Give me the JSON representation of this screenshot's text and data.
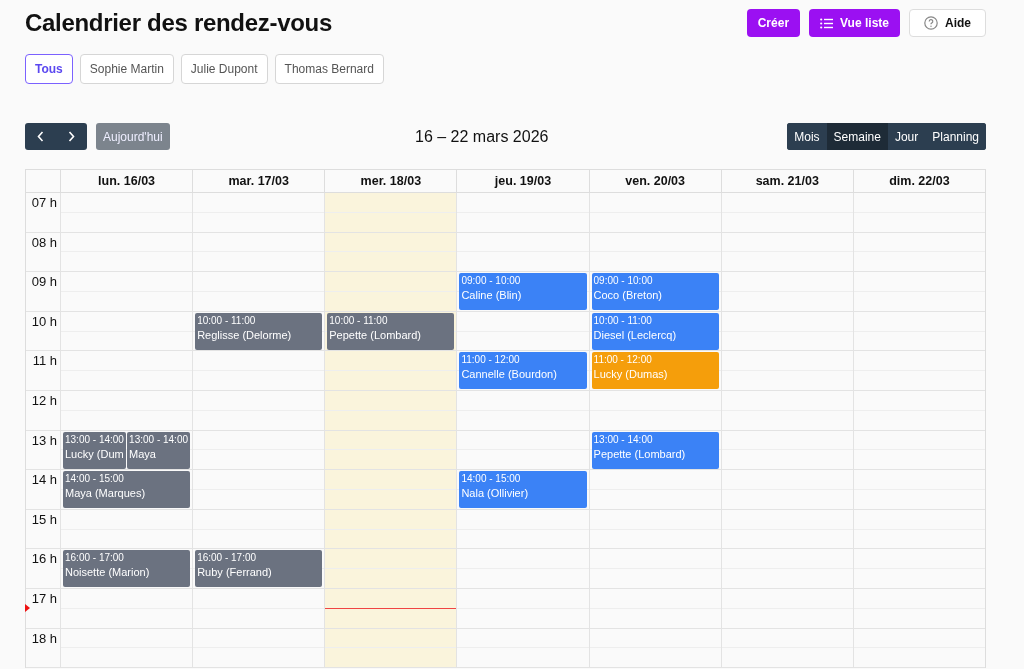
{
  "title": "Calendrier des rendez-vous",
  "actions": [
    {
      "label": "Créer",
      "kind": "primary"
    },
    {
      "label": "Vue liste",
      "kind": "list"
    },
    {
      "label": "Aide",
      "kind": "help"
    }
  ],
  "filters": [
    {
      "label": "Tous",
      "selected": true
    },
    {
      "label": "Sophie Martin",
      "selected": false
    },
    {
      "label": "Julie Dupont",
      "selected": false
    },
    {
      "label": "Thomas Bernard",
      "selected": false
    }
  ],
  "today_button": "Aujourd'hui",
  "range": "16 – 22 mars 2026",
  "views": [
    {
      "label": "Mois",
      "selected": false
    },
    {
      "label": "Semaine",
      "selected": true
    },
    {
      "label": "Jour",
      "selected": false
    },
    {
      "label": "Planning",
      "selected": false
    }
  ],
  "days": [
    {
      "label": "lun. 16/03",
      "today": false
    },
    {
      "label": "mar. 17/03",
      "today": false
    },
    {
      "label": "mer. 18/03",
      "today": true
    },
    {
      "label": "jeu. 19/03",
      "today": false
    },
    {
      "label": "ven. 20/03",
      "today": false
    },
    {
      "label": "sam. 21/03",
      "today": false
    },
    {
      "label": "dim. 22/03",
      "today": false
    }
  ],
  "hours": [
    {
      "label": "07 h",
      "cells": [
        [],
        [],
        [],
        [],
        [],
        [],
        []
      ]
    },
    {
      "label": "08 h",
      "cells": [
        [],
        [],
        [],
        [],
        [],
        [],
        []
      ]
    },
    {
      "label": "09 h",
      "cells": [
        [],
        [],
        [],
        [
          {
            "time": "09:00 - 10:00",
            "title": "Caline (Blin)",
            "color": "#3b82f6"
          }
        ],
        [
          {
            "time": "09:00 - 10:00",
            "title": "Coco (Breton)",
            "color": "#3b82f6"
          }
        ],
        [],
        []
      ]
    },
    {
      "label": "10 h",
      "cells": [
        [],
        [
          {
            "time": "10:00 - 11:00",
            "title": "Reglisse (Delorme)",
            "color": "#6b7280"
          }
        ],
        [
          {
            "time": "10:00 - 11:00",
            "title": "Pepette (Lombard)",
            "color": "#6b7280"
          }
        ],
        [],
        [
          {
            "time": "10:00 - 11:00",
            "title": "Diesel (Leclercq)",
            "color": "#3b82f6"
          }
        ],
        [],
        []
      ]
    },
    {
      "label": "11 h",
      "cells": [
        [],
        [],
        [],
        [
          {
            "time": "11:00 - 12:00",
            "title": "Cannelle (Bourdon)",
            "color": "#3b82f6"
          }
        ],
        [
          {
            "time": "11:00 - 12:00",
            "title": "Lucky (Dumas)",
            "color": "#f59e0b"
          }
        ],
        [],
        []
      ]
    },
    {
      "label": "12 h",
      "cells": [
        [],
        [],
        [],
        [],
        [],
        [],
        []
      ]
    },
    {
      "label": "13 h",
      "cells": [
        [
          {
            "time": "13:00 - 14:00",
            "title": "Lucky (Dum",
            "color": "#6b7280"
          },
          {
            "time": "13:00 - 14:00",
            "title": "Maya",
            "color": "#6b7280"
          }
        ],
        [],
        [],
        [],
        [
          {
            "time": "13:00 - 14:00",
            "title": "Pepette (Lombard)",
            "color": "#3b82f6"
          }
        ],
        [],
        []
      ]
    },
    {
      "label": "14 h",
      "cells": [
        [
          {
            "time": "14:00 - 15:00",
            "title": "Maya (Marques)",
            "color": "#6b7280"
          }
        ],
        [],
        [],
        [
          {
            "time": "14:00 - 15:00",
            "title": "Nala (Ollivier)",
            "color": "#3b82f6"
          }
        ],
        [],
        [],
        []
      ]
    },
    {
      "label": "15 h",
      "cells": [
        [],
        [],
        [],
        [],
        [],
        [],
        []
      ]
    },
    {
      "label": "16 h",
      "cells": [
        [
          {
            "time": "16:00 - 17:00",
            "title": "Noisette (Marion)",
            "color": "#6b7280"
          }
        ],
        [
          {
            "time": "16:00 - 17:00",
            "title": "Ruby (Ferrand)",
            "color": "#6b7280"
          }
        ],
        [],
        [],
        [],
        [],
        []
      ]
    },
    {
      "label": "17 h",
      "now": true,
      "cells": [
        [],
        [],
        [],
        [],
        [],
        [],
        []
      ]
    },
    {
      "label": "18 h",
      "cells": [
        [],
        [],
        [],
        [],
        [],
        [],
        []
      ]
    }
  ]
}
